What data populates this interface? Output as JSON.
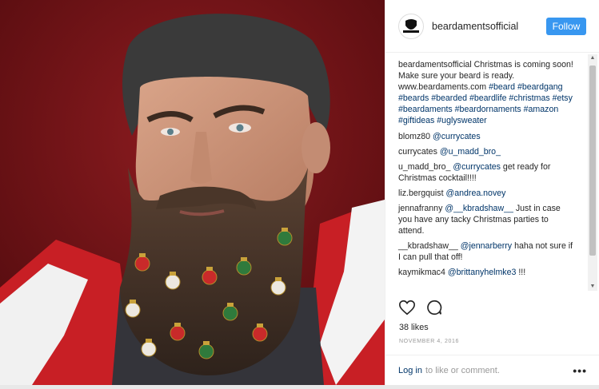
{
  "post": {
    "username": "beardamentsofficial",
    "follow_label": "Follow",
    "avatar_text": "BEARDAMENTS"
  },
  "caption": {
    "user": "beardamentsofficial",
    "text_plain": "Christmas is coming soon! Make sure your beard is ready. www.beardaments.com",
    "hashtags": "#beard #beardgang #beards #bearded #beardlife #christmas #etsy #beardaments #beardornaments #amazon #giftideas #uglysweater"
  },
  "comments": [
    {
      "user": "blomz80",
      "mention": "@currycates",
      "text": ""
    },
    {
      "user": "currycates",
      "mention": "@u_madd_bro_",
      "text": ""
    },
    {
      "user": "u_madd_bro_",
      "mention": "@currycates",
      "text": "get ready for Christmas cocktail!!!!"
    },
    {
      "user": "liz.bergquist",
      "mention": "@andrea.novey",
      "text": ""
    },
    {
      "user": "jennafranny",
      "mention": "@__kbradshaw__",
      "text": "Just in case you have any tacky Christmas parties to attend."
    },
    {
      "user": "__kbradshaw__",
      "mention": "@jennarberry",
      "text": "haha not sure if I can pull that off!"
    },
    {
      "user": "kaymikmac4",
      "mention": "@brittanyhelmke3",
      "text": "!!!"
    }
  ],
  "likes": "38 likes",
  "date": "NOVEMBER 4, 2016",
  "footer": {
    "login": "Log in",
    "rest": "to like or comment."
  },
  "icons": {
    "heart": "heart-icon",
    "comment": "comment-icon",
    "more": "more-options-icon"
  },
  "colors": {
    "follow_button": "#3897f0",
    "link": "#003569",
    "photo_background": "#7a1418"
  }
}
